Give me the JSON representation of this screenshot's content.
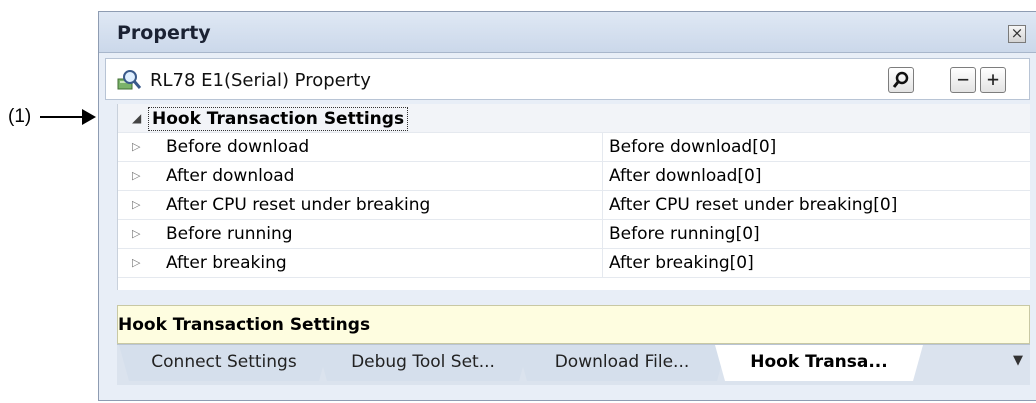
{
  "callout": {
    "label": "(1)"
  },
  "window": {
    "title": "Property"
  },
  "toolbar": {
    "title": "RL78 E1(Serial) Property",
    "search_label": "⌕",
    "collapse_label": "−",
    "expand_label": "+"
  },
  "grid": {
    "category": "Hook Transaction Settings",
    "rows": [
      {
        "name": "Before download",
        "value": "Before download[0]"
      },
      {
        "name": "After download",
        "value": "After download[0]"
      },
      {
        "name": "After CPU reset under breaking",
        "value": "After CPU reset under breaking[0]"
      },
      {
        "name": "Before running",
        "value": "Before running[0]"
      },
      {
        "name": "After breaking",
        "value": "After breaking[0]"
      }
    ]
  },
  "description": {
    "text": "Hook Transaction Settings"
  },
  "tabs": [
    {
      "label": "Connect Settings",
      "active": false
    },
    {
      "label": "Debug Tool Set...",
      "active": false
    },
    {
      "label": "Download File...",
      "active": false
    },
    {
      "label": "Hook  Transa...",
      "active": true
    }
  ],
  "icons": {
    "close": "close-icon",
    "property": "property-magnifier-icon",
    "expanded": "triangle-down-icon",
    "collapsed": "triangle-right-icon",
    "tab_menu": "tab-list-menu-icon"
  },
  "colors": {
    "title_bg": "#cbd8ea",
    "description_bg": "#fefde0",
    "active_tab": "#ffffff",
    "inactive_tab": "#d5dfec"
  }
}
